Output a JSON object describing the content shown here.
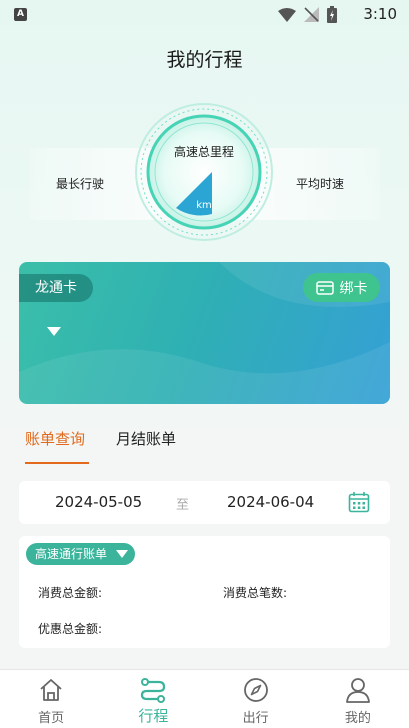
{
  "status_bar": {
    "time": "3:10",
    "badge": "A"
  },
  "header": {
    "title": "我的行程"
  },
  "gauge": {
    "title": "高速总里程",
    "unit": "km",
    "left_label": "最长行驶",
    "right_label": "平均时速"
  },
  "card": {
    "name": "龙通卡",
    "bind_label": "绑卡"
  },
  "tabs": [
    {
      "label": "账单查询",
      "active": true
    },
    {
      "label": "月结账单",
      "active": false
    }
  ],
  "date_range": {
    "start": "2024-05-05",
    "separator": "至",
    "end": "2024-06-04"
  },
  "bill": {
    "type_label": "高速通行账单",
    "total_amount_label": "消费总金额:",
    "total_count_label": "消费总笔数:",
    "discount_label": "优惠总金额:"
  },
  "nav": [
    {
      "label": "首页",
      "icon": "home-icon"
    },
    {
      "label": "行程",
      "icon": "route-icon",
      "active": true
    },
    {
      "label": "出行",
      "icon": "compass-icon"
    },
    {
      "label": "我的",
      "icon": "user-icon"
    }
  ],
  "colors": {
    "accent": "#3bb49b",
    "tab_active": "#e36a1c"
  }
}
